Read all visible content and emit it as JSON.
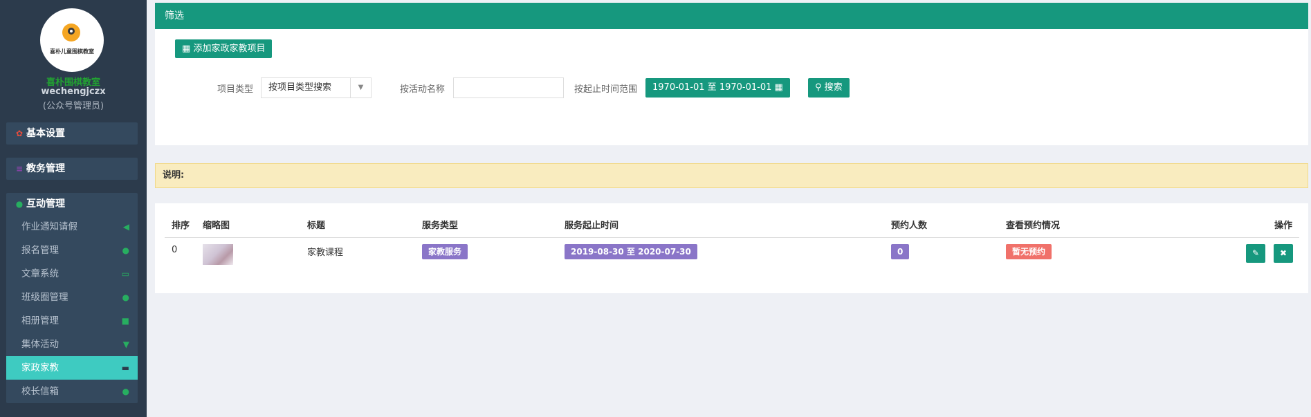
{
  "sidebar": {
    "logo_text": "喜朴儿童围棋教室",
    "brand_name": "喜朴围棋教室",
    "username": "wechengjczx",
    "role": "(公众号管理员)",
    "groups": [
      {
        "label": "基本设置",
        "icon": "gear-icon",
        "color": "#e74c3c"
      },
      {
        "label": "教务管理",
        "icon": "database-icon",
        "color": "#8e44ad"
      },
      {
        "label": "互动管理",
        "icon": "comments-icon",
        "color": "#27ae60"
      }
    ],
    "items": [
      {
        "label": "作业通知请假",
        "icon": "bullhorn-icon"
      },
      {
        "label": "报名管理",
        "icon": "comments-icon"
      },
      {
        "label": "文章系统",
        "icon": "desktop-icon"
      },
      {
        "label": "班级圈管理",
        "icon": "comments-icon"
      },
      {
        "label": "相册管理",
        "icon": "camera-icon"
      },
      {
        "label": "集体活动",
        "icon": "trophy-icon"
      },
      {
        "label": "家政家教",
        "icon": "coffee-icon",
        "active": true
      },
      {
        "label": "校长信箱",
        "icon": "comments-icon"
      }
    ]
  },
  "filter": {
    "title": "筛选",
    "add_button": "添加家政家教项目",
    "type_label": "项目类型",
    "type_value": "按项目类型搜索",
    "name_label": "按活动名称",
    "name_value": "",
    "range_label": "按起止时间范围",
    "range_value": "1970-01-01 至 1970-01-01",
    "search_button": "搜索"
  },
  "notice": {
    "text": "说明:"
  },
  "table": {
    "headers": [
      "排序",
      "缩略图",
      "标题",
      "服务类型",
      "服务起止时间",
      "预约人数",
      "查看预约情况",
      "操作"
    ],
    "rows": [
      {
        "order": "0",
        "title": "家教课程",
        "service_type": "家教服务",
        "period": "2019-08-30 至 2020-07-30",
        "count": "0",
        "status": "暂无预约"
      }
    ]
  },
  "colors": {
    "primary": "#16987e",
    "sidebar": "#2c3b4c",
    "active": "#3ecbc1",
    "purple": "#8a75c8",
    "red": "#f0716a",
    "notice_bg": "#f9ecbf"
  }
}
